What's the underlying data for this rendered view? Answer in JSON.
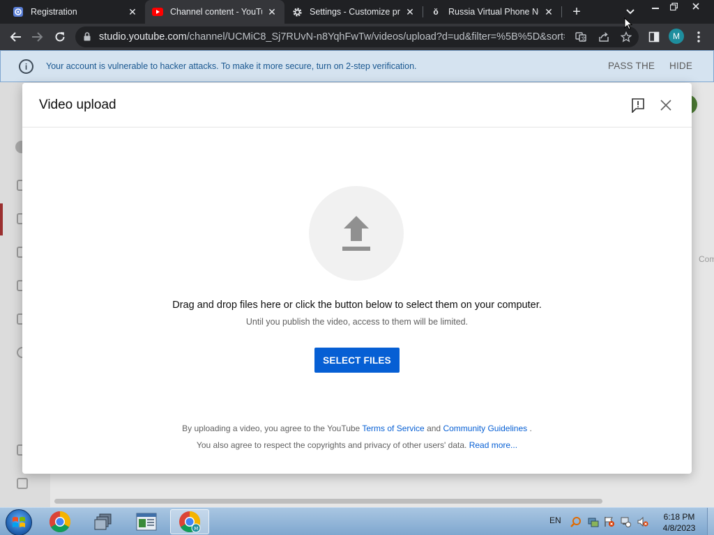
{
  "browser": {
    "tabs": [
      {
        "title": "Registration",
        "favicon": "mail-at-icon",
        "active": false
      },
      {
        "title": "Channel content - YouTube",
        "favicon": "youtube-icon",
        "active": true
      },
      {
        "title": "Settings - Customize profile",
        "favicon": "gear-icon",
        "active": false
      },
      {
        "title": "Russia Virtual Phone Numbers",
        "favicon": "sms-icon",
        "active": false
      }
    ],
    "url_host": "studio.youtube.com",
    "url_path": "/channel/UCMiC8_Sj7RUvN-n8YqhFwTw/videos/upload?d=ud&filter=%5B%5D&sort=...",
    "profile_initial": "M"
  },
  "banner": {
    "message": "Your account is vulnerable to hacker attacks. To make it more secure, turn on 2-step verification.",
    "pass_label": "PASS THE",
    "hide_label": "HIDE"
  },
  "background": {
    "side_text": "Com"
  },
  "dialog": {
    "title": "Video upload",
    "drag_text": "Drag and drop files here or click the button below to select them on your computer.",
    "limit_text": "Until you publish the video, access to them will be limited.",
    "select_button": "SELECT FILES",
    "legal_line1_prefix": "By uploading a video, you agree to the YouTube",
    "terms_link": "Terms of Service",
    "legal_and": "and",
    "guidelines_link": "Community Guidelines",
    "legal_line1_suffix": ".",
    "legal_line2_prefix": "You also agree to respect the copyrights and privacy of other users' data.",
    "read_more_link": "Read more..."
  },
  "taskbar": {
    "language": "EN",
    "time": "6:18 PM",
    "date": "4/8/2023"
  },
  "colors": {
    "accent_blue": "#065fd4",
    "banner_bg": "#d5e3f0",
    "banner_text": "#18568f",
    "chrome_dark": "#202124"
  }
}
